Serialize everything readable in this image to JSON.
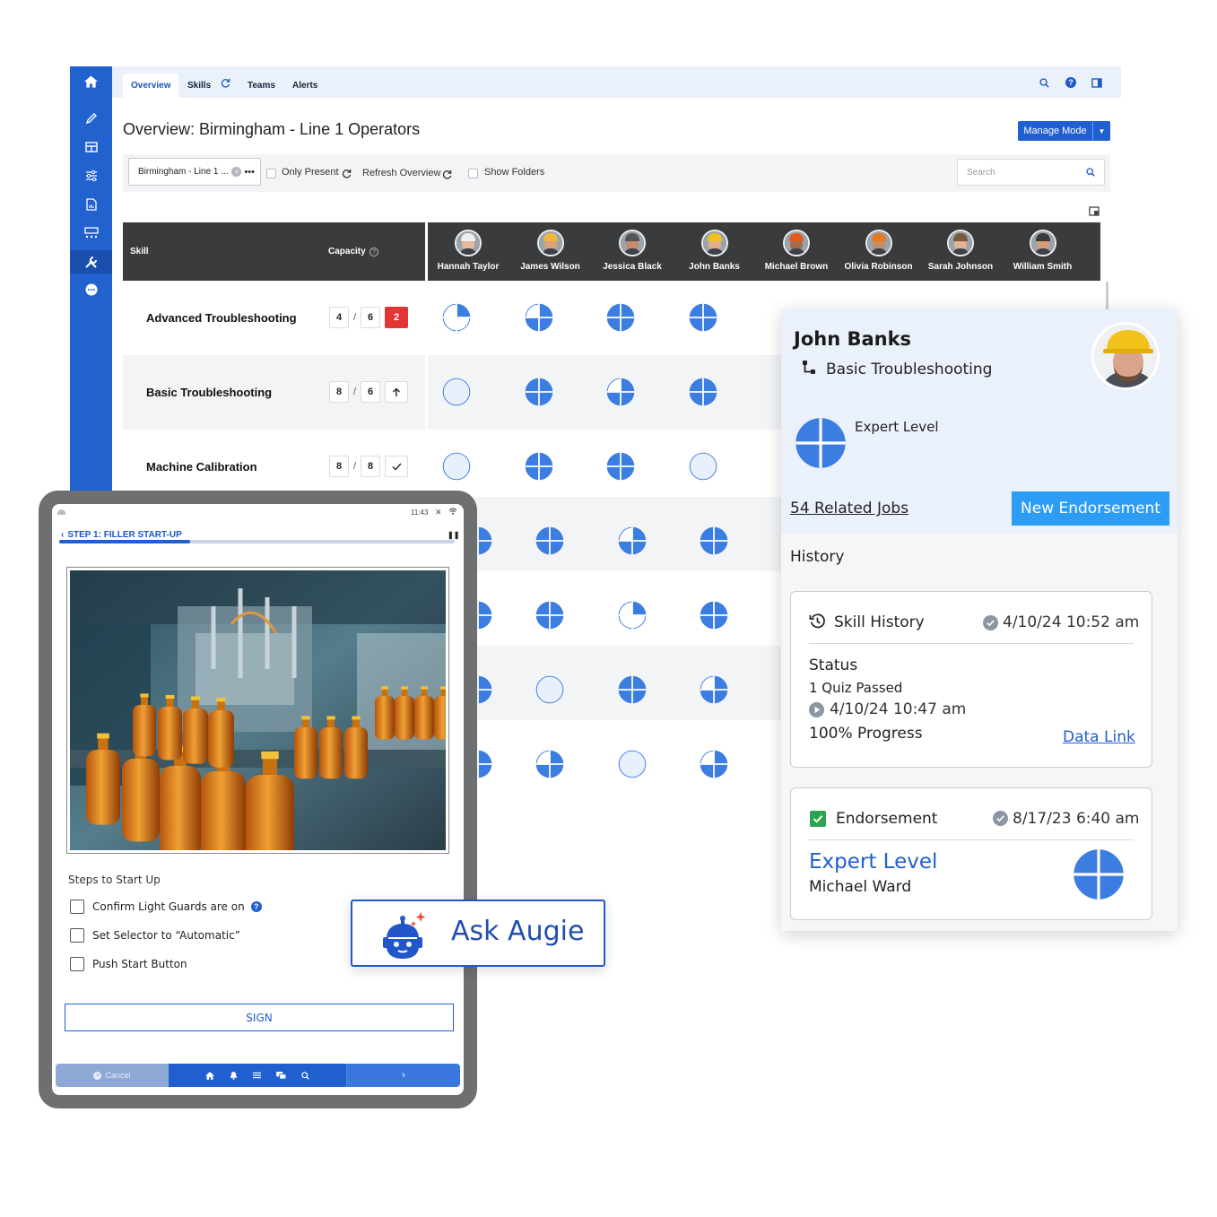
{
  "app": {
    "tabs": [
      {
        "label": "Overview"
      },
      {
        "label": "Skills"
      },
      {
        "label": "Teams"
      },
      {
        "label": "Alerts"
      }
    ],
    "title": "Overview: Birmingham - Line 1 Operators",
    "manage_mode": "Manage Mode",
    "filters": {
      "location_value": "Birmingham - Line 1 ...",
      "only_present": "Only Present",
      "refresh": "Refresh Overview",
      "show_folders": "Show Folders",
      "search_placeholder": "Search"
    },
    "grid": {
      "skill_header": "Skill",
      "capacity_header": "Capacity",
      "people": [
        "Hannah Taylor",
        "James Wilson",
        "Jessica Black",
        "John Banks",
        "Michael Brown",
        "Olivia Robinson",
        "Sarah Johnson",
        "William Smith"
      ],
      "rows": [
        {
          "skill": "Advanced Troubleshooting",
          "have": "4",
          "need": "6",
          "status": "2",
          "status_kind": "deficit",
          "levels": [
            1,
            3,
            4,
            4
          ]
        },
        {
          "skill": "Basic Troubleshooting",
          "have": "8",
          "need": "6",
          "status": "arrow-up-icon",
          "status_kind": "surplus",
          "levels": [
            0,
            4,
            3,
            4
          ]
        },
        {
          "skill": "Machine Calibration",
          "have": "8",
          "need": "8",
          "status": "check-icon",
          "status_kind": "met",
          "levels": [
            0,
            4,
            4,
            0
          ]
        }
      ],
      "lower_levels": [
        [
          4,
          4,
          3,
          4
        ],
        [
          4,
          4,
          1,
          4
        ],
        [
          4,
          0,
          4,
          3
        ],
        [
          3,
          3,
          0,
          3
        ]
      ]
    }
  },
  "panel": {
    "name": "John Banks",
    "skill": "Basic Troubleshooting",
    "level_label": "Expert Level",
    "level_value": 4,
    "related_jobs": "54 Related Jobs",
    "new_endorsement": "New Endorsement",
    "history_label": "History",
    "skill_history": {
      "title": "Skill History",
      "timestamp": "4/10/24 10:52 am",
      "status_label": "Status",
      "quiz": "1 Quiz Passed",
      "quiz_time": "4/10/24 10:47 am",
      "progress": "100% Progress",
      "data_link": "Data Link"
    },
    "endorsement": {
      "title": "Endorsement",
      "timestamp": "8/17/23 6:40 am",
      "level": "Expert Level",
      "by": "Michael Ward",
      "level_value": 4
    }
  },
  "tablet": {
    "time": "11:43",
    "step_label": "STEP 1:  FILLER START-UP",
    "progress": 0.33,
    "steps_title": "Steps to Start Up",
    "steps": [
      "Confirm Light Guards are on",
      "Set Selector to “Automatic”",
      "Push Start Button"
    ],
    "sign": "SIGN",
    "cancel": "Cancel"
  },
  "augie": {
    "label": "Ask Augie"
  },
  "colors": {
    "brand_blue": "#1f5fd0",
    "rail_blue": "#2162cf",
    "skill_pie": "#3b7de0",
    "deficit_red": "#e23535",
    "endorse_button": "#2d9cf5"
  }
}
